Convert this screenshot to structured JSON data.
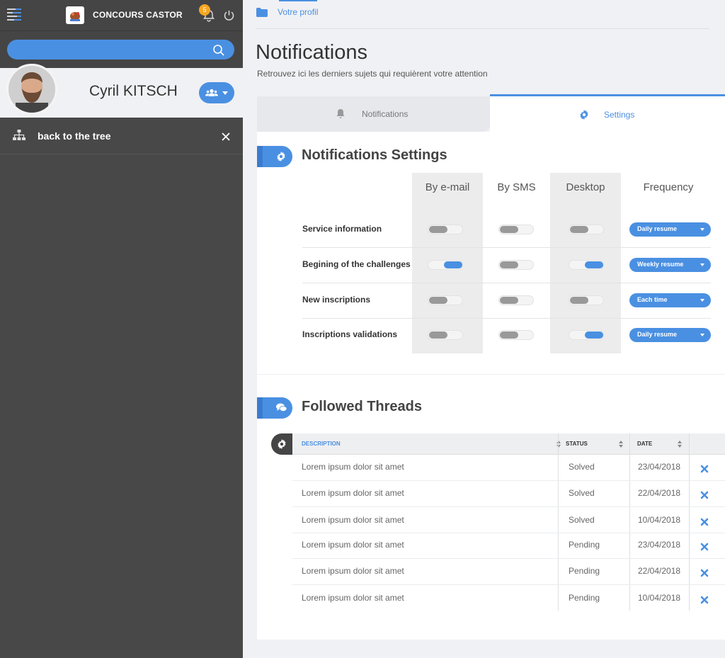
{
  "app": {
    "brand": "CONCOURS CASTOR",
    "notification_count": "5",
    "search_placeholder": "",
    "user_name": "Cyril KITSCH",
    "back_tree_label": "back to the tree"
  },
  "breadcrumb": {
    "label": "Votre profil"
  },
  "page": {
    "title": "Notifications",
    "subtitle": "Retrouvez ici les derniers sujets qui requièrent votre attention"
  },
  "tabs": [
    {
      "label": "Notifications",
      "active": false
    },
    {
      "label": "Settings",
      "active": true
    }
  ],
  "settings": {
    "title": "Notifications Settings",
    "columns": [
      "By e-mail",
      "By SMS",
      "Desktop",
      "Frequency"
    ],
    "rows": [
      {
        "label": "Service information",
        "email": false,
        "sms": false,
        "desktop": false,
        "frequency": "Daily resume"
      },
      {
        "label": "Begining of the challenges",
        "email": true,
        "sms": false,
        "desktop": true,
        "frequency": "Weekly resume"
      },
      {
        "label": "New inscriptions",
        "email": false,
        "sms": false,
        "desktop": false,
        "frequency": "Each time"
      },
      {
        "label": "Inscriptions validations",
        "email": false,
        "sms": false,
        "desktop": true,
        "frequency": "Daily resume"
      }
    ]
  },
  "threads": {
    "title": "Followed Threads",
    "headers": [
      "DESCRIPTION",
      "STATUS",
      "DATE"
    ],
    "rows": [
      {
        "description": "Lorem ipsum dolor sit amet",
        "status": "Solved",
        "date": "23/04/2018"
      },
      {
        "description": "Lorem ipsum dolor sit amet",
        "status": "Solved",
        "date": "22/04/2018"
      },
      {
        "description": "Lorem ipsum dolor sit amet",
        "status": "Solved",
        "date": "10/04/2018"
      },
      {
        "description": "Lorem ipsum dolor sit amet",
        "status": "Pending",
        "date": "23/04/2018"
      },
      {
        "description": "Lorem ipsum dolor sit amet",
        "status": "Pending",
        "date": "22/04/2018"
      },
      {
        "description": "Lorem ipsum dolor sit amet",
        "status": "Pending",
        "date": "10/04/2018"
      }
    ]
  },
  "colors": {
    "accent": "#4a90e2",
    "sidebar": "#484848",
    "badge": "#f5a623"
  },
  "icons": [
    "menu-icon",
    "beaver-logo-icon",
    "bell-icon",
    "power-icon",
    "search-icon",
    "users-icon",
    "sitemap-icon",
    "close-icon",
    "folder-icon",
    "gear-icon",
    "comments-icon",
    "sort-icon",
    "delete-icon"
  ]
}
